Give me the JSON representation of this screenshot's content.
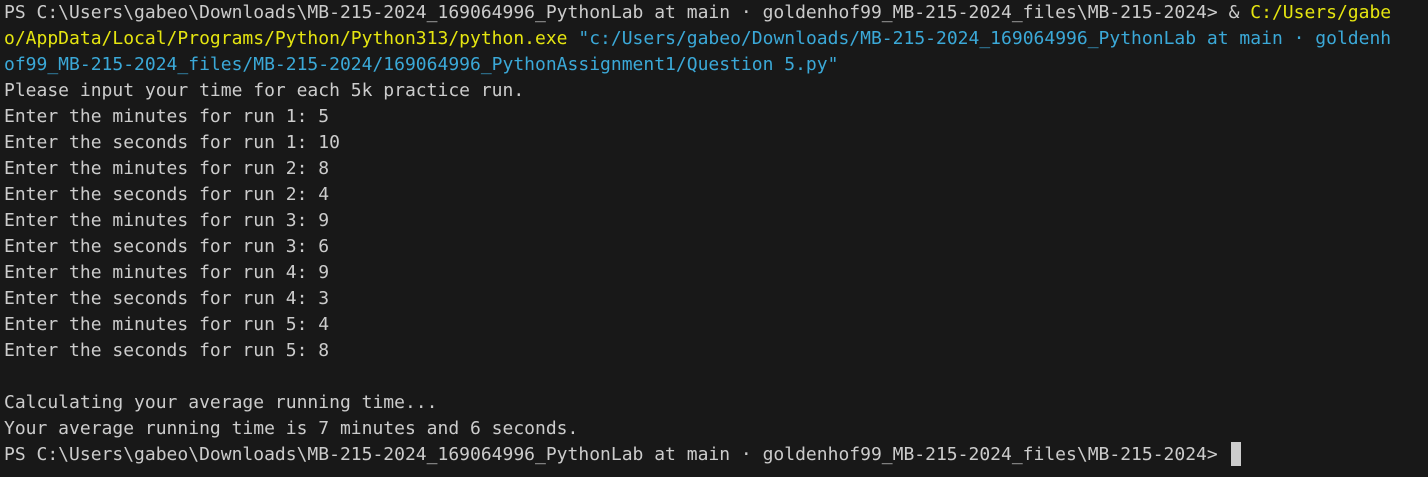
{
  "prompt": {
    "ps_path": "PS C:\\Users\\gabeo\\Downloads\\MB-215-2024_169064996_PythonLab at main · goldenhof99_MB-215-2024_files\\MB-215-2024> ",
    "amp": "& ",
    "exe_l1": "C:/Users/gabe",
    "exe_l2": "o/AppData/Local/Programs/Python/Python313/python.exe",
    "space": " ",
    "script_l2": "\"c:/Users/gabeo/Downloads/MB-215-2024_169064996_PythonLab at main · goldenh",
    "script_l3": "of99_MB-215-2024_files/MB-215-2024/169064996_PythonAssignment1/Question 5.py\""
  },
  "output": {
    "intro": "Please input your time for each 5k practice run.",
    "runs": [
      "Enter the minutes for run 1: 5",
      "Enter the seconds for run 1: 10",
      "Enter the minutes for run 2: 8",
      "Enter the seconds for run 2: 4",
      "Enter the minutes for run 3: 9",
      "Enter the seconds for run 3: 6",
      "Enter the minutes for run 4: 9",
      "Enter the seconds for run 4: 3",
      "Enter the minutes for run 5: 4",
      "Enter the seconds for run 5: 8"
    ],
    "calculating": "Calculating your average running time...",
    "result": "Your average running time is 7 minutes and 6 seconds."
  },
  "final_prompt": "PS C:\\Users\\gabeo\\Downloads\\MB-215-2024_169064996_PythonLab at main · goldenhof99_MB-215-2024_files\\MB-215-2024> ",
  "colors": {
    "background": "#181818",
    "text": "#cccccc",
    "command": "#e5e510",
    "string": "#3ba9d8"
  }
}
